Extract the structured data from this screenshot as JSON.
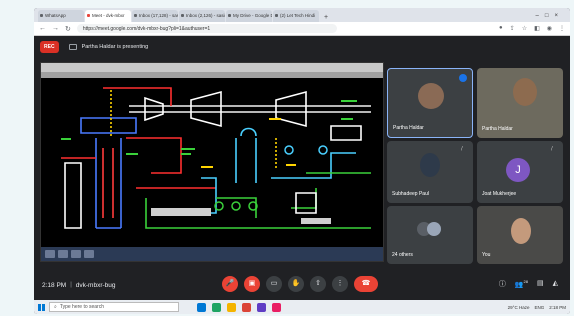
{
  "browser": {
    "tabs": [
      {
        "label": "WhatsApp",
        "active": false
      },
      {
        "label": "Meet - dvk-mbxr",
        "active": true
      },
      {
        "label": "Inbox (17,128) - sasin",
        "active": false
      },
      {
        "label": "Inbox (2,126) - sasin",
        "active": false
      },
      {
        "label": "My Drive - Google D",
        "active": false
      },
      {
        "label": "(2) Let Tech Hindi",
        "active": false
      }
    ],
    "url": "https://meet.google.com/dvk-mbxr-bug?pli=1&authuser=1"
  },
  "meet": {
    "rec_label": "REC",
    "presenting_text": "Partha Haldar is presenting",
    "participants": [
      {
        "name": "Partha Haldar",
        "speaking": true
      },
      {
        "name": "Partha Haldar",
        "speaking": false
      },
      {
        "name": "Subhadeep Paul",
        "speaking": false
      },
      {
        "name": "Joat Mukherjee",
        "initial": "J",
        "speaking": false
      },
      {
        "name": "24 others",
        "speaking": false
      },
      {
        "name": "You",
        "speaking": false
      }
    ],
    "time": "2:18 PM",
    "meeting_code": "dvk-mbxr-bug",
    "participant_count": "28"
  },
  "taskbar": {
    "search_placeholder": "Type here to search",
    "weather": "29°C Haze",
    "lang": "ENG",
    "clock_time": "2:18 PM"
  },
  "colors": {
    "accent": "#1a73e8",
    "end_call": "#ea4335",
    "letter_avatar": "#7e57c2"
  }
}
